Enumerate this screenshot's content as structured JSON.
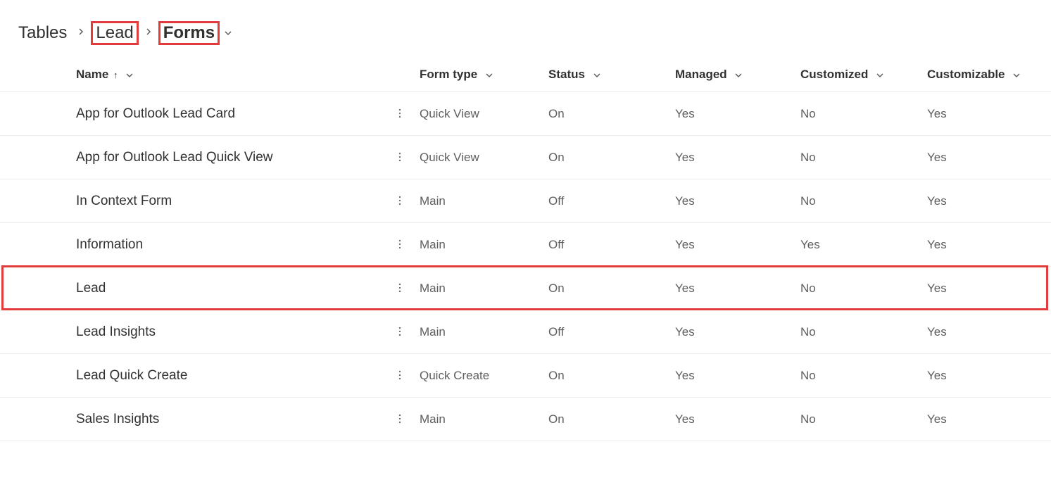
{
  "breadcrumb": {
    "root": "Tables",
    "table": "Lead",
    "section": "Forms"
  },
  "columns": {
    "name": "Name",
    "formtype": "Form type",
    "status": "Status",
    "managed": "Managed",
    "customized": "Customized",
    "customizable": "Customizable"
  },
  "rows": [
    {
      "name": "App for Outlook Lead Card",
      "formtype": "Quick View",
      "status": "On",
      "managed": "Yes",
      "customized": "No",
      "customizable": "Yes"
    },
    {
      "name": "App for Outlook Lead Quick View",
      "formtype": "Quick View",
      "status": "On",
      "managed": "Yes",
      "customized": "No",
      "customizable": "Yes"
    },
    {
      "name": "In Context Form",
      "formtype": "Main",
      "status": "Off",
      "managed": "Yes",
      "customized": "No",
      "customizable": "Yes"
    },
    {
      "name": "Information",
      "formtype": "Main",
      "status": "Off",
      "managed": "Yes",
      "customized": "Yes",
      "customizable": "Yes"
    },
    {
      "name": "Lead",
      "formtype": "Main",
      "status": "On",
      "managed": "Yes",
      "customized": "No",
      "customizable": "Yes"
    },
    {
      "name": "Lead Insights",
      "formtype": "Main",
      "status": "Off",
      "managed": "Yes",
      "customized": "No",
      "customizable": "Yes"
    },
    {
      "name": "Lead Quick Create",
      "formtype": "Quick Create",
      "status": "On",
      "managed": "Yes",
      "customized": "No",
      "customizable": "Yes"
    },
    {
      "name": "Sales Insights",
      "formtype": "Main",
      "status": "On",
      "managed": "Yes",
      "customized": "No",
      "customizable": "Yes"
    }
  ],
  "highlighted_row_index": 4
}
